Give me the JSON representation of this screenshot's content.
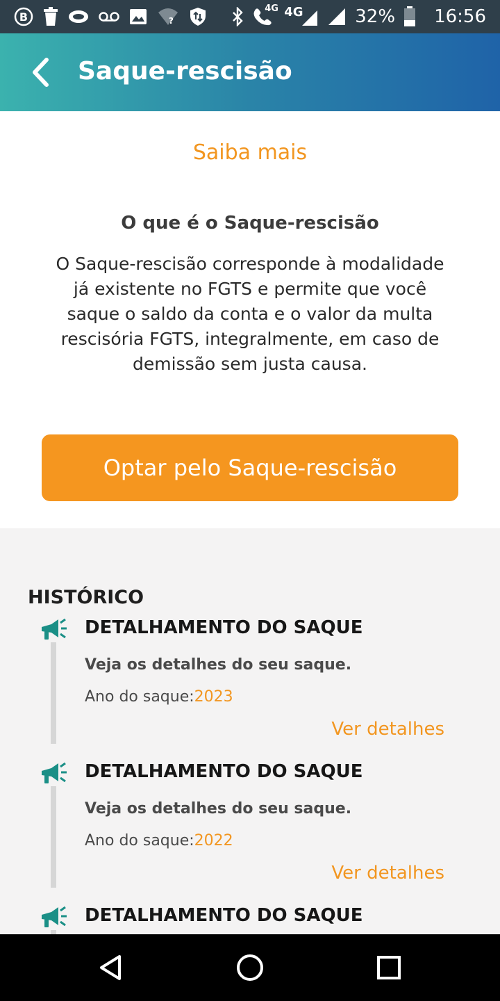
{
  "status_bar": {
    "network_label": "4G",
    "call_network_label": "4G",
    "battery": "32%",
    "time": "16:56",
    "left_icons": [
      "b-badge-icon",
      "trash-icon",
      "eye-icon",
      "voicemail-icon",
      "image-icon",
      "wifi-question-icon",
      "shield-icon"
    ],
    "right_icons": [
      "bluetooth-icon",
      "wifi-call-icon",
      "signal-icon",
      "signal-icon",
      "battery-icon"
    ]
  },
  "app_bar": {
    "title": "Saque-rescisão",
    "back_icon": "chevron-left-icon"
  },
  "info": {
    "saiba_mais": "Saiba mais",
    "title": "O que é o Saque-rescisão",
    "body_lines": [
      "O Saque-rescisão corresponde à modalidade",
      "já existente no FGTS e permite que você",
      "saque o saldo da conta e o valor da multa",
      "rescisória FGTS, integralmente, em caso de",
      "demissão sem justa causa."
    ],
    "button_label": "Optar pelo Saque-rescisão"
  },
  "history": {
    "title": "HISTÓRICO",
    "items": [
      {
        "title": "DETALHAMENTO DO SAQUE",
        "description": "Veja os detalhes do seu saque.",
        "year_label": "Ano do saque:",
        "year": "2023",
        "link": "Ver detalhes"
      },
      {
        "title": "DETALHAMENTO DO SAQUE",
        "description": "Veja os detalhes do seu saque.",
        "year_label": "Ano do saque:",
        "year": "2022",
        "link": "Ver detalhes"
      },
      {
        "title": "DETALHAMENTO DO SAQUE"
      }
    ]
  },
  "nav_bar": {
    "icons": [
      "back-triangle-icon",
      "home-circle-icon",
      "recents-square-icon"
    ]
  },
  "colors": {
    "accent_orange": "#f5961f",
    "link_orange": "#f29620",
    "megaphone_teal": "#1a8f86",
    "status_bar": "#2f3f4a"
  }
}
